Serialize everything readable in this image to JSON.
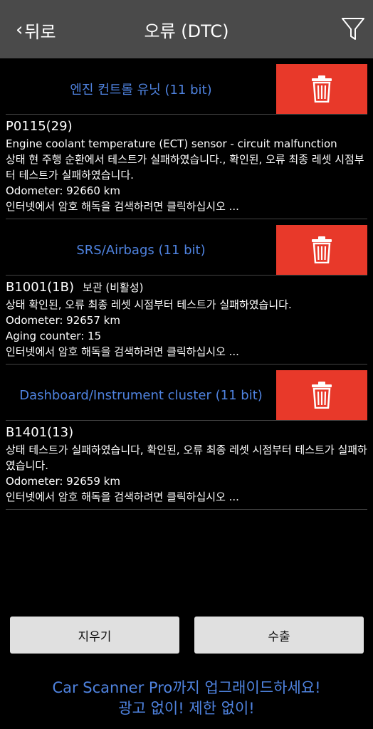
{
  "header": {
    "back_label": "뒤로",
    "title": "오류 (DTC)"
  },
  "groups": [
    {
      "name": "엔진 컨트롤 유닛 (11 bit)",
      "entries": [
        {
          "code": "P0115(29)",
          "status": "",
          "description": "Engine coolant temperature (ECT) sensor - circuit malfunction",
          "state": "상태 현 주행 순환에서 테스트가 실패하였습니다., 확인된, 오류 최종 레셋 시점부터 테스트가 실패하였습니다.",
          "odometer": "Odometer: 92660 km",
          "aging": "",
          "search": "인터넷에서 암호 해독을 검색하려면 클릭하십시오 ..."
        }
      ]
    },
    {
      "name": "SRS/Airbags (11 bit)",
      "entries": [
        {
          "code": "B1001(1B)",
          "status": "보관 (비활성)",
          "description": "",
          "state": "상태 확인된, 오류 최종 레셋 시점부터 테스트가 실패하였습니다.",
          "odometer": "Odometer: 92657 km",
          "aging": "Aging counter: 15",
          "search": "인터넷에서 암호 해독을 검색하려면 클릭하십시오 ..."
        }
      ]
    },
    {
      "name": "Dashboard/Instrument cluster (11 bit)",
      "entries": [
        {
          "code": "B1401(13)",
          "status": "",
          "description": "",
          "state": "상태 테스트가 실패하였습니다, 확인된, 오류 최종 레셋 시점부터 테스트가 실패하였습니다.",
          "odometer": "Odometer: 92659 km",
          "aging": "",
          "search": "인터넷에서 암호 해독을 검색하려면 클릭하십시오 ..."
        }
      ]
    }
  ],
  "buttons": {
    "clear_label": "지우기",
    "export_label": "수출"
  },
  "promo": {
    "line1": "Car Scanner Pro까지 업그래이드하세요!",
    "line2": "광고 없이! 제한 없이!"
  },
  "colors": {
    "header_bg": "#4a4a4a",
    "accent": "#4f83e0",
    "delete": "#e8392a"
  },
  "icons": {
    "back": "chevron-left-icon",
    "filter": "filter-icon",
    "delete": "trash-icon"
  }
}
